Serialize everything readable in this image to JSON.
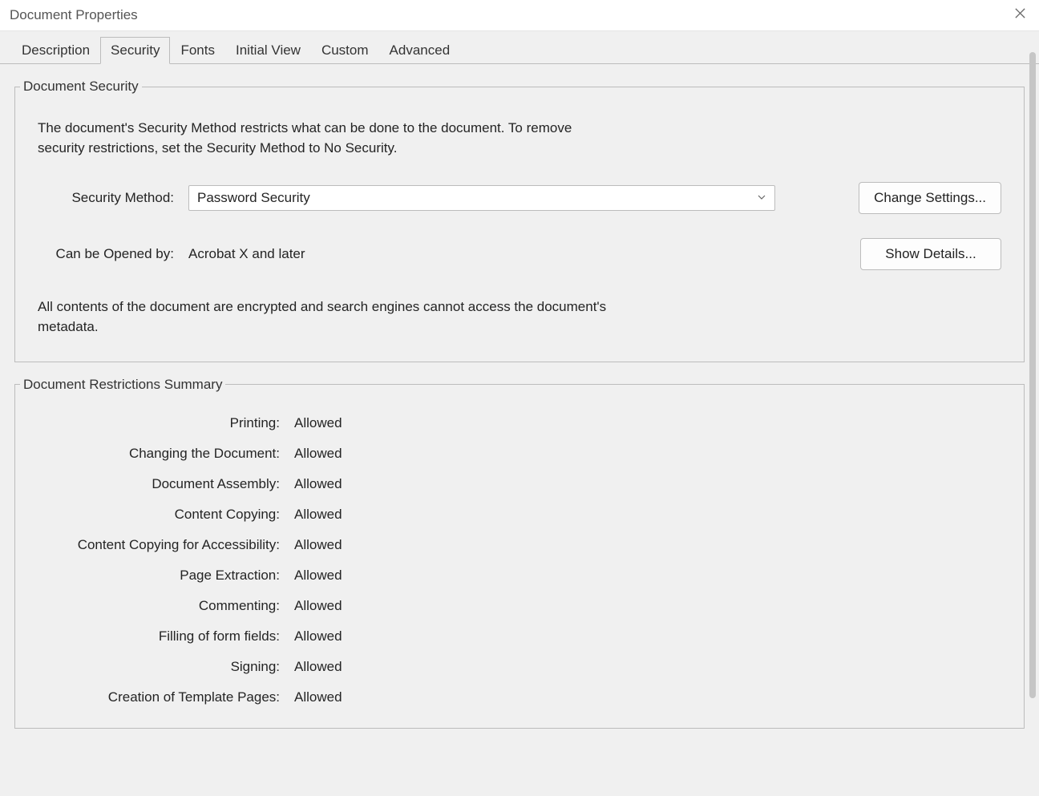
{
  "window": {
    "title": "Document Properties"
  },
  "tabs": {
    "description": "Description",
    "security": "Security",
    "fonts": "Fonts",
    "initial_view": "Initial View",
    "custom": "Custom",
    "advanced": "Advanced"
  },
  "security_group": {
    "legend": "Document Security",
    "description": "The document's Security Method restricts what can be done to the document. To remove security restrictions, set the Security Method to No Security.",
    "method_label": "Security Method:",
    "method_value": "Password Security",
    "change_btn": "Change Settings...",
    "opened_by_label": "Can be Opened by:",
    "opened_by_value": "Acrobat X and later",
    "show_details_btn": "Show Details...",
    "encryption_note": "All contents of the document are encrypted and search engines cannot access the document's metadata."
  },
  "restrictions_group": {
    "legend": "Document Restrictions Summary",
    "rows": [
      {
        "label": "Printing:",
        "value": "Allowed"
      },
      {
        "label": "Changing the Document:",
        "value": "Allowed"
      },
      {
        "label": "Document Assembly:",
        "value": "Allowed"
      },
      {
        "label": "Content Copying:",
        "value": "Allowed"
      },
      {
        "label": "Content Copying for Accessibility:",
        "value": "Allowed"
      },
      {
        "label": "Page Extraction:",
        "value": "Allowed"
      },
      {
        "label": "Commenting:",
        "value": "Allowed"
      },
      {
        "label": "Filling of form fields:",
        "value": "Allowed"
      },
      {
        "label": "Signing:",
        "value": "Allowed"
      },
      {
        "label": "Creation of Template Pages:",
        "value": "Allowed"
      }
    ]
  }
}
